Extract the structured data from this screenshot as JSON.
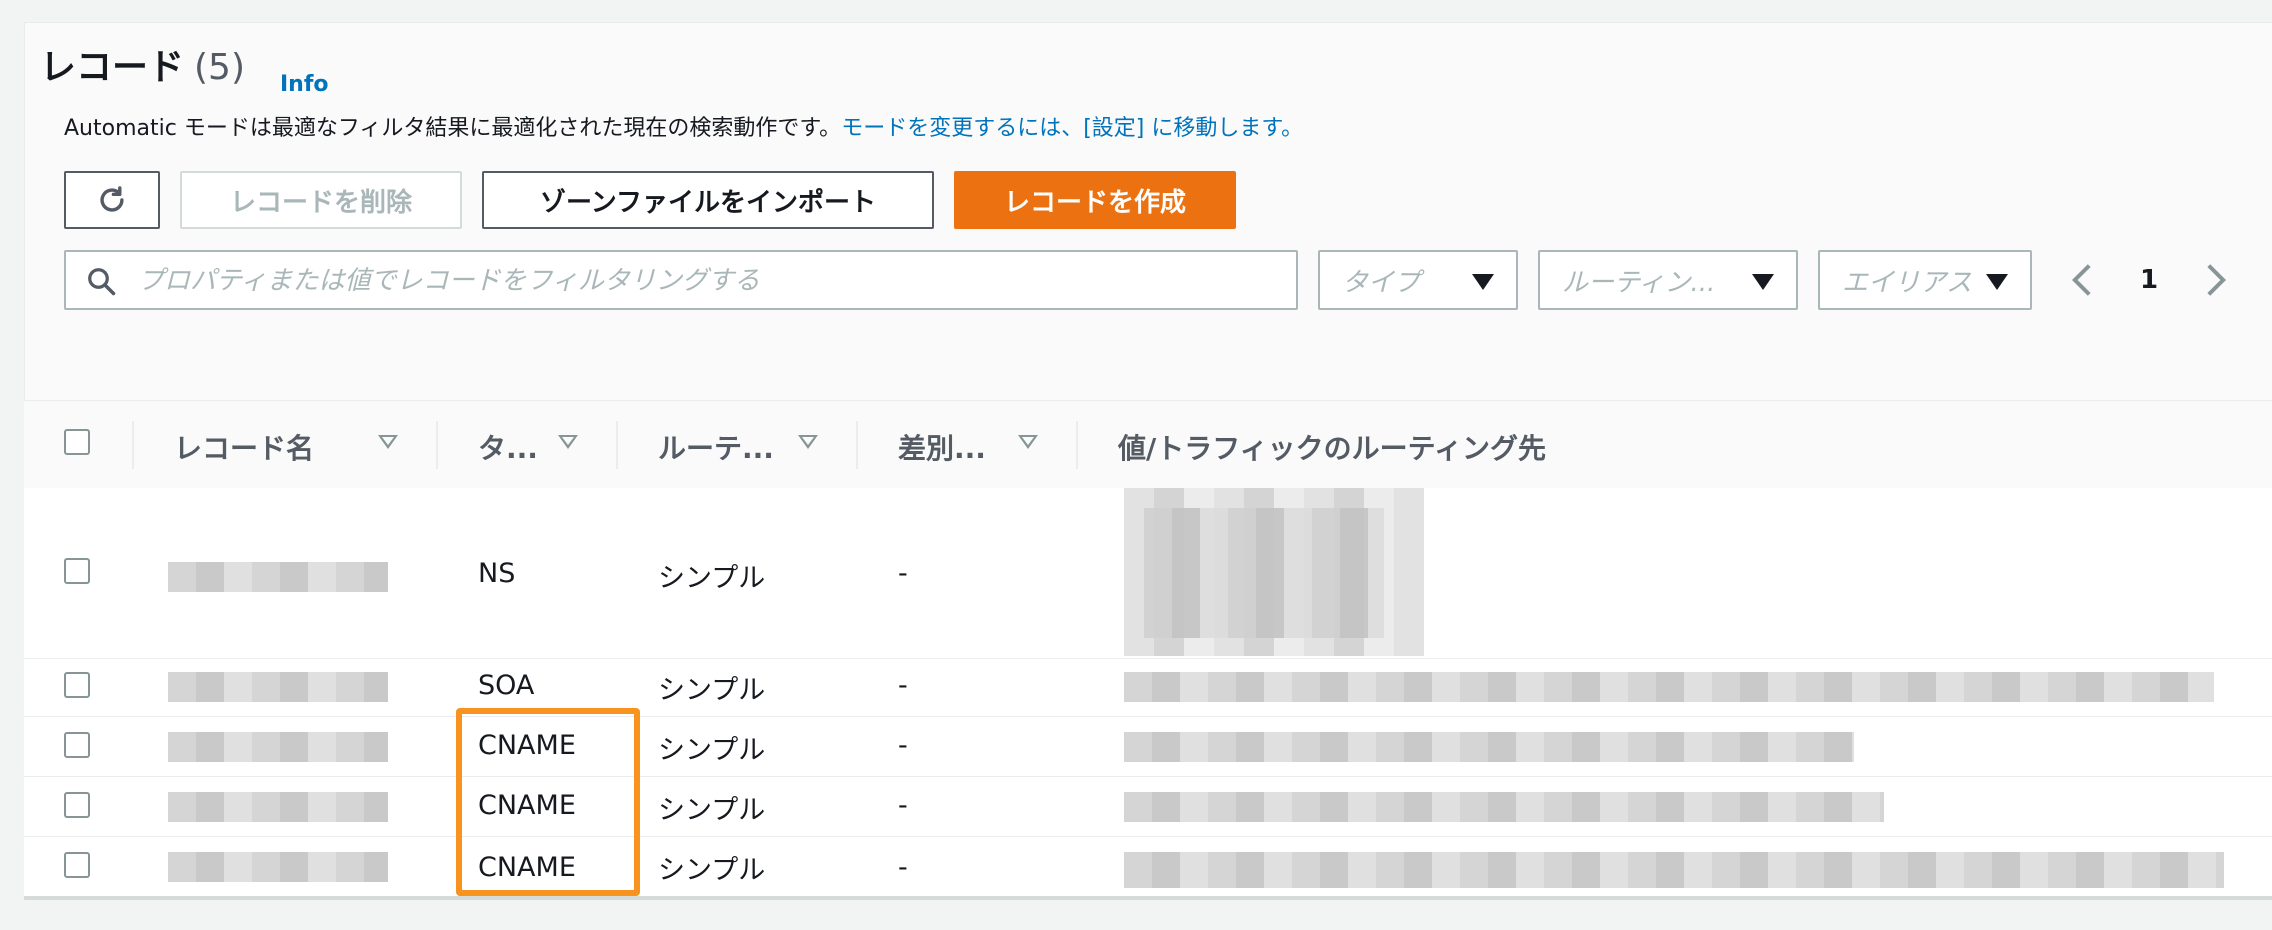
{
  "header": {
    "title": "レコード",
    "count": "(5)",
    "info": "Info",
    "description": "Automatic モードは最適なフィルタ結果に最適化された現在の検索動作です。",
    "description_link": "モードを変更するには、[設定] に移動します。"
  },
  "toolbar": {
    "delete_label": "レコードを削除",
    "import_label": "ゾーンファイルをインポート",
    "create_label": "レコードを作成"
  },
  "filter": {
    "search_placeholder": "プロパティまたは値でレコードをフィルタリングする",
    "type_placeholder": "タイプ",
    "routing_placeholder": "ルーティン...",
    "alias_placeholder": "エイリアス"
  },
  "pagination": {
    "current_page": "1"
  },
  "table": {
    "columns": [
      "レコード名",
      "タ...",
      "ルーテ...",
      "差別...",
      "値/トラフィックのルーティング先"
    ],
    "rows": [
      {
        "type": "NS",
        "routing": "シンプル",
        "differentiator": "-"
      },
      {
        "type": "SOA",
        "routing": "シンプル",
        "differentiator": "-"
      },
      {
        "type": "CNAME",
        "routing": "シンプル",
        "differentiator": "-"
      },
      {
        "type": "CNAME",
        "routing": "シンプル",
        "differentiator": "-"
      },
      {
        "type": "CNAME",
        "routing": "シンプル",
        "differentiator": "-"
      }
    ]
  },
  "colors": {
    "accent": "#ec7211",
    "link": "#0073bb",
    "highlight": "#f7931e"
  }
}
